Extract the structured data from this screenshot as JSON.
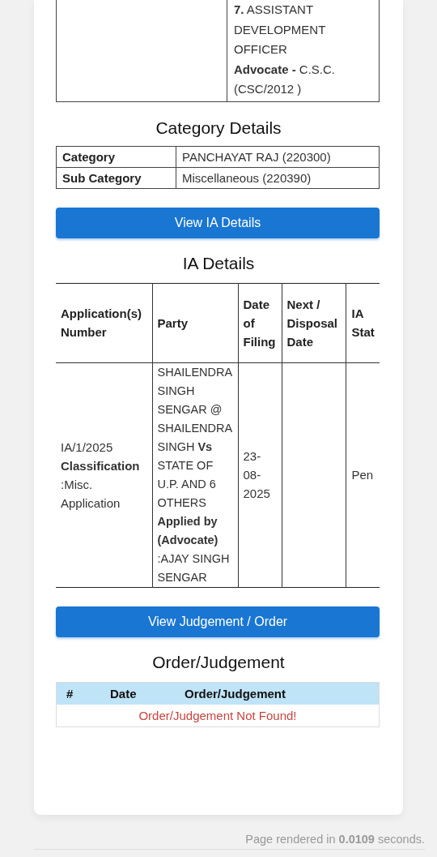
{
  "top_table": {
    "right_cell_lines": [
      "**7.** ASSISTANT DEVELOPMENT OFFICER",
      "**Advocate -** C.S.C. (CSC/2012 )"
    ]
  },
  "category_details": {
    "title": "Category Details",
    "rows": [
      {
        "label": "Category",
        "value": "PANCHAYAT RAJ (220300)"
      },
      {
        "label": "Sub Category",
        "value": "Miscellaneous (220390)"
      }
    ]
  },
  "view_ia_button": "View IA Details",
  "ia_details": {
    "title": "IA Details",
    "columns": [
      "Application(s) Number",
      "Party",
      "Date of Filing",
      "Next / Disposal Date",
      "IA Stat"
    ],
    "rows": [
      {
        "cells": [
          "IA/1/2025 **Classification** :Misc. Application",
          "SHAILENDRA SINGH SENGAR @ SHAILENDRA SINGH **Vs** STATE OF U.P. AND 6 OTHERS **Applied by (Advocate)** :AJAY SINGH SENGAR",
          "23-08-2025",
          "",
          "Pen"
        ]
      }
    ]
  },
  "view_judgement_button": "View Judgement / Order",
  "order_judgement": {
    "title": "Order/Judgement",
    "columns": [
      "#",
      "Date",
      "Order/Judgement"
    ],
    "empty_message": "Order/Judgement Not Found!"
  },
  "footer": "Page rendered in **0.0109** seconds."
}
